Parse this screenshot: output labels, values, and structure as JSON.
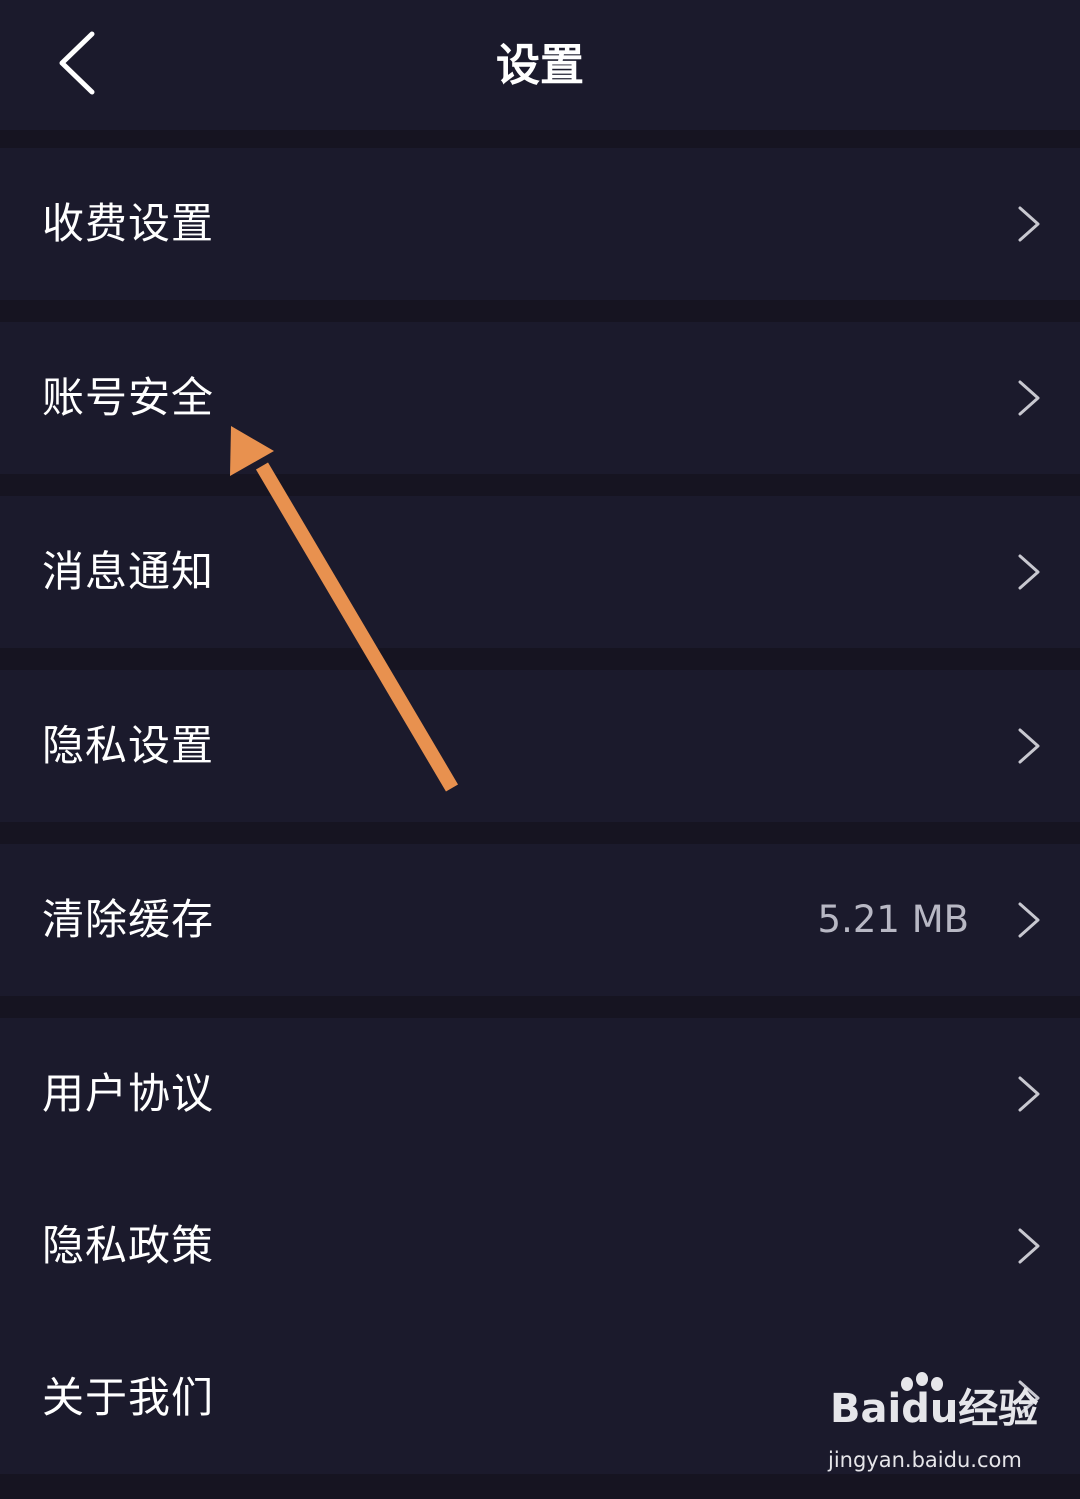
{
  "header": {
    "title": "设置",
    "back_icon": "chevron-left-icon"
  },
  "settings": {
    "items": [
      {
        "label": "收费设置",
        "value": ""
      },
      {
        "label": "账号安全",
        "value": ""
      },
      {
        "label": "消息通知",
        "value": ""
      },
      {
        "label": "隐私设置",
        "value": ""
      },
      {
        "label": "清除缓存",
        "value": "5.21 MB"
      },
      {
        "label": "用户协议",
        "value": ""
      },
      {
        "label": "隐私政策",
        "value": ""
      },
      {
        "label": "关于我们",
        "value": ""
      }
    ]
  },
  "annotation": {
    "arrow_color": "#e8914f"
  },
  "watermark": {
    "brand": "Baidu经验",
    "url": "jingyan.baidu.com"
  },
  "colors": {
    "background": "#161421",
    "surface": "#1b1a2c",
    "text": "#ffffff",
    "secondary_text": "#b8b8c4",
    "chevron": "#c8c8d0"
  }
}
